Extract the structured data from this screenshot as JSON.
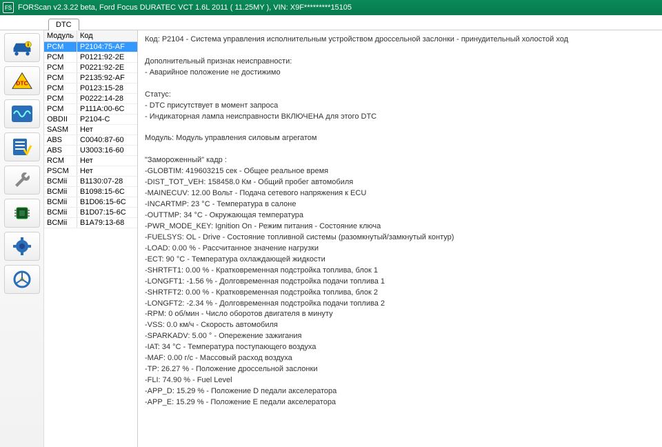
{
  "titlebar": "FORScan v2.3.22 beta, Ford Focus DURATEC VCT 1.6L 2011 ( 11.25MY ), VIN: X9F*********15105",
  "tab": "DTC",
  "table_headers": {
    "module": "Модуль",
    "code": "Код"
  },
  "dtc_rows": [
    {
      "module": "PCM",
      "code": "P2104:75-AF",
      "selected": true
    },
    {
      "module": "PCM",
      "code": "P0121:92-2E"
    },
    {
      "module": "PCM",
      "code": "P0221:92-2E"
    },
    {
      "module": "PCM",
      "code": "P2135:92-AF"
    },
    {
      "module": "PCM",
      "code": "P0123:15-28"
    },
    {
      "module": "PCM",
      "code": "P0222:14-28"
    },
    {
      "module": "PCM",
      "code": "P111A:00-6C"
    },
    {
      "module": "OBDII",
      "code": "P2104-C"
    },
    {
      "module": "SASM",
      "code": "Нет"
    },
    {
      "module": "ABS",
      "code": "C0040:87-60"
    },
    {
      "module": "ABS",
      "code": "U3003:16-60"
    },
    {
      "module": "RCM",
      "code": "Нет"
    },
    {
      "module": "PSCM",
      "code": "Нет"
    },
    {
      "module": "BCMii",
      "code": "B1130:07-28"
    },
    {
      "module": "BCMii",
      "code": "B1098:15-6C"
    },
    {
      "module": "BCMii",
      "code": "B1D06:15-6C"
    },
    {
      "module": "BCMii",
      "code": "B1D07:15-6C"
    },
    {
      "module": "BCMii",
      "code": "B1A79:13-68"
    }
  ],
  "detail": {
    "code_line": "Код: P2104 - Система управления исполнительным устройством дроссельной заслонки - принудительный холостой ход",
    "add_label": "Дополнительный признак неисправности:",
    "add_1": " - Аварийное положение не достижимо",
    "status_label": "Статус:",
    "status_1": " - DTC присутствует в момент запроса",
    "status_2": " - Индикаторная лампа неисправности ВКЛЮЧЕНА для этого DTC",
    "module_line": "Модуль: Модуль управления силовым агрегатом",
    "freeze_label": " \"Замороженный\" кадр :",
    "params": [
      "-GLOBTIM: 419603215 сек - Общее реальное время",
      "-DIST_TOT_VEH: 158458.0 Км - Общий пробег автомобиля",
      "-MAINECUV: 12.00 Вольт - Подача сетевого напряжения к ECU",
      "-INCARTMP: 23 °C - Температура в салоне",
      "-OUTTMP: 34 °C - Окружающая температура",
      "-PWR_MODE_KEY: Ignition On - Режим питания - Состояние ключа",
      "-FUELSYS: OL - Drive  - Состояние топливной системы (разомкнутый/замкнутый контур)",
      "-LOAD: 0.00 % - Рассчитанное значение нагрузки",
      "-ECT: 90 °C - Температура охлаждающей жидкости",
      "-SHRTFT1: 0.00 % - Кратковременная подстройка топлива, блок 1",
      "-LONGFT1: -1.56 % - Долговременная подстройка подачи топлива 1",
      "-SHRTFT2: 0.00 % - Кратковременная подстройка топлива, блок 2",
      "-LONGFT2: -2.34 % - Долговременная подстройка подачи топлива 2",
      "-RPM: 0 об/мин - Число оборотов двигателя в минуту",
      "-VSS: 0.0 км/ч - Скорость автомобиля",
      "-SPARKADV: 5.00 ° - Опережение зажигания",
      "-IAT: 34 °C - Температура поступающего воздуха",
      "-MAF: 0.00 г/с - Массовый расход воздуха",
      "-TP: 26.27 % - Положение дроссельной заслонки",
      "-FLI: 74.90 % - Fuel Level",
      "-APP_D: 15.29 % - Положение D педали акселератора",
      "-APP_E: 15.29 % - Положение E педали акселератора"
    ]
  }
}
